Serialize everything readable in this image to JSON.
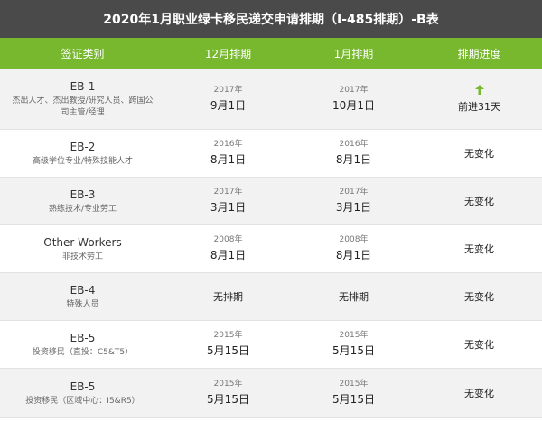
{
  "title": "2020年1月职业绿卡移民递交申请排期（I-485排期）-B表",
  "colors": {
    "header_bg": "#77b82e",
    "title_bg": "#4a4a4a",
    "alt_row": "#f2f2f2",
    "arrow": "#77b82e"
  },
  "headers": [
    "签证类别",
    "12月排期",
    "1月排期",
    "排期进度"
  ],
  "rows": [
    {
      "cat": "EB-1",
      "desc": "杰出人才、杰出教授/研究人员、跨国公司主管/经理",
      "dec_year": "2017年",
      "dec_day": "9月1日",
      "jan_year": "2017年",
      "jan_day": "10月1日",
      "progress": "前进31天",
      "arrow": "up-arrow-icon"
    },
    {
      "cat": "EB-2",
      "desc": "高级学位专业/特殊技能人才",
      "dec_year": "2016年",
      "dec_day": "8月1日",
      "jan_year": "2016年",
      "jan_day": "8月1日",
      "progress": "无变化"
    },
    {
      "cat": "EB-3",
      "desc": "熟练技术/专业劳工",
      "dec_year": "2017年",
      "dec_day": "3月1日",
      "jan_year": "2017年",
      "jan_day": "3月1日",
      "progress": "无变化"
    },
    {
      "cat": "Other Workers",
      "desc": "非技术劳工",
      "dec_year": "2008年",
      "dec_day": "8月1日",
      "jan_year": "2008年",
      "jan_day": "8月1日",
      "progress": "无变化"
    },
    {
      "cat": "EB-4",
      "desc": "特殊人员",
      "dec_none": "无排期",
      "jan_none": "无排期",
      "progress": "无变化"
    },
    {
      "cat": "EB-5",
      "desc": "投资移民（直投：C5&T5）",
      "dec_year": "2015年",
      "dec_day": "5月15日",
      "jan_year": "2015年",
      "jan_day": "5月15日",
      "progress": "无变化"
    },
    {
      "cat": "EB-5",
      "desc": "投资移民（区域中心：I5&R5）",
      "dec_year": "2015年",
      "dec_day": "5月15日",
      "jan_year": "2015年",
      "jan_day": "5月15日",
      "progress": "无变化"
    }
  ]
}
